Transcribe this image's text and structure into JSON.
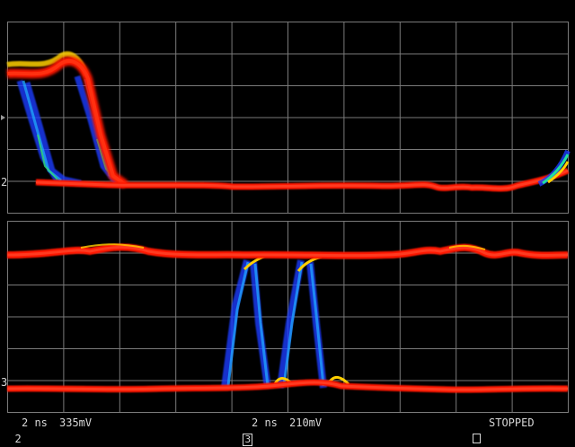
{
  "colors": {
    "background": "#000000",
    "grid": "#7a7a7a",
    "text": "#d8d8d8",
    "persistence_hot": "#ff1800",
    "persistence_warm": "#ffd000",
    "persistence_mid": "#20e060",
    "persistence_cold": "#1040ff"
  },
  "upper_display": {
    "channel_marker": "2",
    "trigger_marker": "trigger-arrow-icon"
  },
  "lower_display": {
    "channel_marker": "3"
  },
  "status_bar": {
    "ch2_number": "2",
    "ch2_timebase": "2 ns",
    "ch2_scale": "335mV",
    "ch3_number": "3",
    "ch3_timebase": "2 ns",
    "ch3_scale": "210mV",
    "run_indicator_icon": "stop-square-icon",
    "run_state": "STOPPED"
  }
}
